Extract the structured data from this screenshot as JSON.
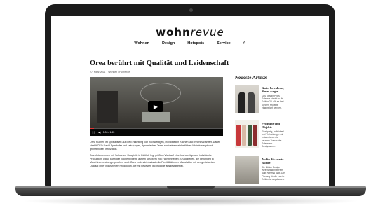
{
  "site": {
    "logo_bold": "wohn",
    "logo_italic": "revue",
    "nav": [
      "Wohnen",
      "Design",
      "Hotspots",
      "Service"
    ],
    "search_icon": "search-icon"
  },
  "article": {
    "title": "Orea berührt mit Qualität und Leidenschaft",
    "date": "27. März 2021",
    "category": "Wohnen / Führende",
    "video_time": "0:00 / 1:55",
    "paragraph1": "Orea Küchen ist spezialisiert auf die Einrichtung von hochwertigen, individuellen Küchen und Innenmaßanfert. Daher strahlt CEO David Spielhofer und sein junges, dynamisches Team nach einem einheitlichen Wohnkonzept und grenzenloser Innovation.",
    "paragraph2": "Das Unternehmen mit Schweizer Hauptsitz in Dättlich legt größten Wert auf eine hochwertige und individuelle Produktion. Dafür kann der Küchenexperte auf ein Netzwerk von Fachbetrieben zurückgreifen, die gebündelt in Maschinen und angesprochen sind. Orea verbindet dadurch die Flexibilität einer Manufaktur mit der gesicherten Qualität einer industriellen Produktion, die mit neuester Technologie ausgestattet ist."
  },
  "sidebar": {
    "title": "Neueste Artikel",
    "items": [
      {
        "heading": "Gutes bewahren, Neues wagen",
        "desc": "Das Design-Profs Schweiz startet in die Edition 23. Ob es fast können Projekte eingereicht werden."
      },
      {
        "heading": "Produkte und Objekte",
        "desc": "Einzigartig, individuell und Verlockung – wir präsentieren die neusten Trends der Schweizer Designszene."
      },
      {
        "heading": "Auf in die zweite Runde",
        "desc": "Die Zürich Design Weeks finden bereits statt zweimal statt. Die Planung für die zweite Edition ist angelaufen."
      }
    ]
  },
  "colors": {
    "accent": "#d33",
    "laptop": "#1c1c1c"
  }
}
